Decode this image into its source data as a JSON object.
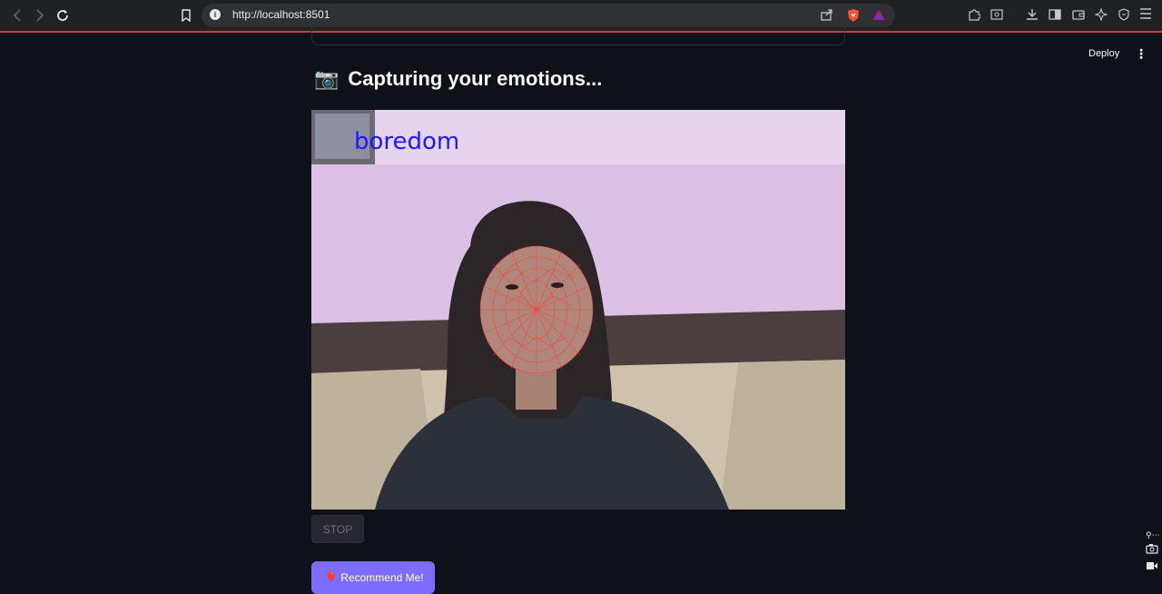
{
  "browser": {
    "url": "http://localhost:8501",
    "back_icon": "chevron-left-icon",
    "forward_icon": "chevron-right-icon",
    "reload_icon": "reload-icon"
  },
  "header": {
    "deploy_label": "Deploy"
  },
  "main": {
    "heading_icon": "📷",
    "heading": "Capturing your emotions...",
    "overlay_label": "boredom",
    "stop_label": "STOP",
    "recommend_label": "🎈 Recommend Me!"
  },
  "colors": {
    "accent": "#7c6cff",
    "overlay_text": "#1a1aff",
    "mesh": "#ff3b3b"
  }
}
